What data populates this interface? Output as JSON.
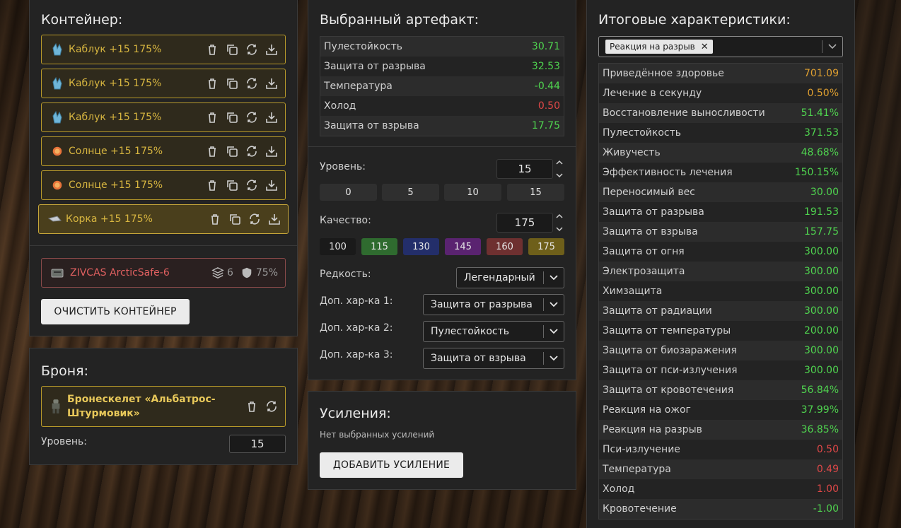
{
  "colors": {
    "accent_gold": "#d8b640",
    "green": "#4fd44f",
    "red": "#e04848",
    "orange": "#e0a030"
  },
  "container": {
    "title": "Контейнер:",
    "artifacts": [
      {
        "label": "Каблук +15 175%",
        "icon": "crystal-icon"
      },
      {
        "label": "Каблук +15 175%",
        "icon": "crystal-icon"
      },
      {
        "label": "Каблук +15 175%",
        "icon": "crystal-icon"
      },
      {
        "label": "Солнце +15 175%",
        "icon": "sun-orb-icon"
      },
      {
        "label": "Солнце +15 175%",
        "icon": "sun-orb-icon"
      },
      {
        "label": "Корка +15 175%",
        "icon": "shard-icon"
      }
    ],
    "case": {
      "name": "ZIVCAS ArcticSafe-6",
      "slots": "6",
      "protection": "75%"
    },
    "clear_label": "ОЧИСТИТЬ КОНТЕЙНЕР"
  },
  "armor": {
    "title": "Броня:",
    "name": "Бронескелет «Альбатрос-Штурмовик»",
    "level_label": "Уровень:",
    "level_value": "15"
  },
  "selected": {
    "title": "Выбранный артефакт:",
    "stats": [
      {
        "name": "Пулестойкость",
        "value": "30.71",
        "color": "green"
      },
      {
        "name": "Защита от разрыва",
        "value": "32.53",
        "color": "green"
      },
      {
        "name": "Температура",
        "value": "-0.44",
        "color": "green"
      },
      {
        "name": "Холод",
        "value": "0.50",
        "color": "red"
      },
      {
        "name": "Защита от взрыва",
        "value": "17.75",
        "color": "green"
      }
    ],
    "level_label": "Уровень:",
    "level_value": "15",
    "level_presets": [
      "0",
      "5",
      "10",
      "15"
    ],
    "quality_label": "Качество:",
    "quality_value": "175",
    "quality_presets": [
      {
        "label": "100",
        "bg": "#1a1a1a"
      },
      {
        "label": "115",
        "bg": "#2f6b2f"
      },
      {
        "label": "130",
        "bg": "#232e6a"
      },
      {
        "label": "145",
        "bg": "#5a2370"
      },
      {
        "label": "160",
        "bg": "#6e3030"
      },
      {
        "label": "175",
        "bg": "#6e5f1a"
      }
    ],
    "rarity_label": "Редкость:",
    "rarity_value": "Легендарный",
    "extra1_label": "Доп. хар-ка 1:",
    "extra1_value": "Защита от разрыва",
    "extra2_label": "Доп. хар-ка 2:",
    "extra2_value": "Пулестойкость",
    "extra3_label": "Доп. хар-ка 3:",
    "extra3_value": "Защита от взрыва"
  },
  "upgrades": {
    "title": "Усиления:",
    "empty_text": "Нет выбранных усилений",
    "add_label": "ДОБАВИТЬ УСИЛЕНИЕ"
  },
  "final": {
    "title": "Итоговые характеристики:",
    "filter_chip": "Реакция на разрыв",
    "stats": [
      {
        "name": "Приведённое здоровье",
        "value": "701.09",
        "color": "orange"
      },
      {
        "name": "Лечение в секунду",
        "value": "0.50%",
        "color": "orange"
      },
      {
        "name": "Восстановление выносливости",
        "value": "51.41%",
        "color": "green"
      },
      {
        "name": "Пулестойкость",
        "value": "371.53",
        "color": "green"
      },
      {
        "name": "Живучесть",
        "value": "48.68%",
        "color": "green"
      },
      {
        "name": "Эффективность лечения",
        "value": "150.15%",
        "color": "green"
      },
      {
        "name": "Переносимый вес",
        "value": "30.00",
        "color": "green"
      },
      {
        "name": "Защита от разрыва",
        "value": "191.53",
        "color": "green"
      },
      {
        "name": "Защита от взрыва",
        "value": "157.75",
        "color": "green"
      },
      {
        "name": "Защита от огня",
        "value": "300.00",
        "color": "green"
      },
      {
        "name": "Электрозащита",
        "value": "300.00",
        "color": "green"
      },
      {
        "name": "Химзащита",
        "value": "300.00",
        "color": "green"
      },
      {
        "name": "Защита от радиации",
        "value": "300.00",
        "color": "green"
      },
      {
        "name": "Защита от температуры",
        "value": "200.00",
        "color": "green"
      },
      {
        "name": "Защита от биозаражения",
        "value": "300.00",
        "color": "green"
      },
      {
        "name": "Защита от пси-излучения",
        "value": "300.00",
        "color": "green"
      },
      {
        "name": "Защита от кровотечения",
        "value": "56.84%",
        "color": "green"
      },
      {
        "name": "Реакция на ожог",
        "value": "37.99%",
        "color": "green"
      },
      {
        "name": "Реакция на разрыв",
        "value": "36.85%",
        "color": "green"
      },
      {
        "name": "Пси-излучение",
        "value": "0.50",
        "color": "red"
      },
      {
        "name": "Температура",
        "value": "0.49",
        "color": "red"
      },
      {
        "name": "Холод",
        "value": "1.00",
        "color": "red"
      },
      {
        "name": "Кровотечение",
        "value": "-1.00",
        "color": "green"
      }
    ]
  }
}
